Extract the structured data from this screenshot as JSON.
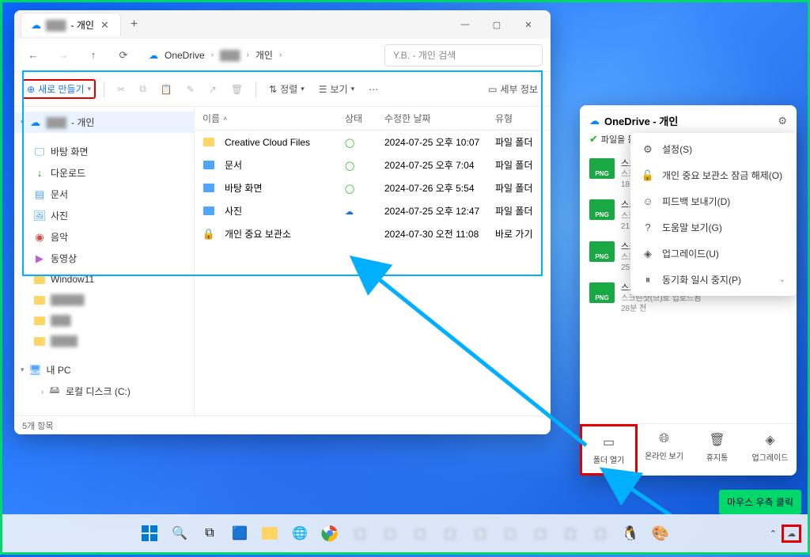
{
  "explorer": {
    "tab_title_suffix": " - 개인",
    "address": {
      "root": "OneDrive",
      "path2": "개인"
    },
    "search_placeholder": "Y.B. - 개인 검색",
    "toolbar": {
      "new_label": "새로 만들기",
      "sort_label": "정렬",
      "view_label": "보기",
      "details_label": "세부 정보"
    },
    "columns": {
      "name": "이름",
      "status": "상태",
      "date": "수정한 날짜",
      "type": "유형"
    },
    "sidebar": {
      "onedrive_suffix": " - 개인",
      "desktop": "바탕 화면",
      "downloads": "다운로드",
      "documents": "문서",
      "pictures": "사진",
      "music": "음악",
      "videos": "동영상",
      "window11": "Window11",
      "this_pc": "내 PC",
      "local_disk": "로컬 디스크 (C:)"
    },
    "files": [
      {
        "name": "Creative Cloud Files",
        "status": "sync",
        "date": "2024-07-25 오후 10:07",
        "type": "파일 폴더",
        "icon": "folder-yellow"
      },
      {
        "name": "문서",
        "status": "sync",
        "date": "2024-07-25 오후 7:04",
        "type": "파일 폴더",
        "icon": "folder-blue"
      },
      {
        "name": "바탕 화면",
        "status": "sync",
        "date": "2024-07-26 오후 5:54",
        "type": "파일 폴더",
        "icon": "folder-blue"
      },
      {
        "name": "사진",
        "status": "cloud",
        "date": "2024-07-25 오후 12:47",
        "type": "파일 폴더",
        "icon": "folder-blue"
      },
      {
        "name": "개인 중요 보관소",
        "status": "none",
        "date": "2024-07-30 오전 11:08",
        "type": "바로 가기",
        "icon": "vault"
      }
    ],
    "status_text": "5개 항목"
  },
  "flyout": {
    "title": "OneDrive - 개인",
    "sync_status": "파일을 동기화하고 있습니다",
    "menu": {
      "settings": "설정(S)",
      "unlock_vault": "개인 중요 보관소 잠금 해제(O)",
      "feedback": "피드백 보내기(D)",
      "help": "도움말 보기(G)",
      "upgrade": "업그레이드(U)",
      "pause": "동기화 일시 중지(P)"
    },
    "recent": [
      {
        "name": "스크…",
        "sub1": "스크린샷",
        "sub2": "18분 전"
      },
      {
        "name": "스크…",
        "sub1": "스크린샷",
        "sub2": "21분 전"
      },
      {
        "name": "스크…",
        "sub1": "스크린샷",
        "sub2": "25분 전"
      },
      {
        "name": "스크린샷 2024-07-30 173708.png",
        "sub1": "스크린샷(으)로 업로드됨",
        "sub2": "28분 전"
      }
    ],
    "actions": {
      "open_folder": "폴더 열기",
      "view_online": "온라인 보기",
      "recycle": "휴지통",
      "upgrade": "업그레이드"
    }
  },
  "annotation": {
    "tooltip": "마우스 우측 클릭"
  }
}
